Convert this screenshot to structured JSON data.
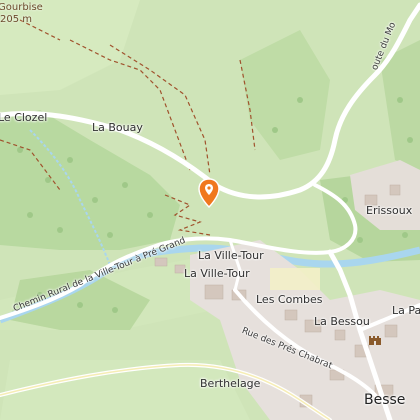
{
  "map": {
    "place_labels": [
      "La Bouay",
      "Le Clozel",
      "La Ville-Tour",
      "La Ville-Tour",
      "Les Combes",
      "La Bessou",
      "Erissoux",
      "Berthelage",
      "Besse",
      "La Pa"
    ],
    "peak": {
      "name": "Gourbise",
      "elevation": "205 m"
    },
    "roads": {
      "chemin_rural": "Chemin Rural de la Ville-Tour à Pré Grand",
      "rue_pres_chabrat": "Rue des Prés Chabrat",
      "route_du_mo": "oute du Mo"
    },
    "marker": {
      "icon": "map-pin-icon",
      "color": "#f0781e"
    },
    "colors": {
      "land": "#cfe4b8",
      "forest": "#b7d8a0",
      "road": "#ffffff",
      "water": "#a9d6ee",
      "trail": "#a0522d",
      "built": "#e6e0dc"
    }
  }
}
